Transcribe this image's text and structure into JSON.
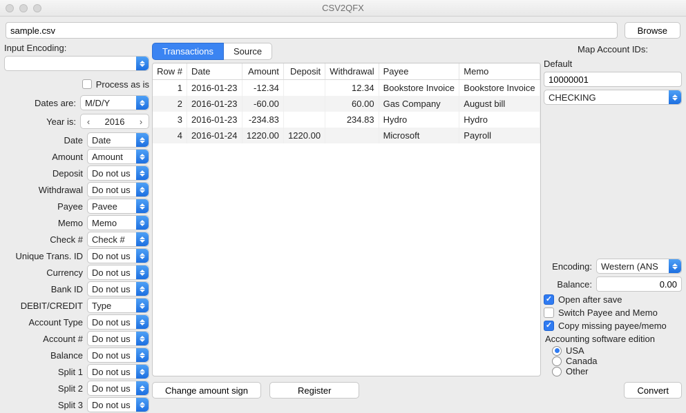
{
  "window": {
    "title": "CSV2QFX"
  },
  "filebar": {
    "path": "sample.csv",
    "browse": "Browse"
  },
  "left": {
    "input_encoding_label": "Input Encoding:",
    "input_encoding_value": "",
    "process_as_is": "Process as is",
    "dates_are_label": "Dates are:",
    "dates_are_value": "M/D/Y",
    "year_is_label": "Year is:",
    "year_is_value": "2016",
    "fields": [
      {
        "label": "Date",
        "value": "Date"
      },
      {
        "label": "Amount",
        "value": "Amount"
      },
      {
        "label": "Deposit",
        "value": "Do not us"
      },
      {
        "label": "Withdrawal",
        "value": "Do not us"
      },
      {
        "label": "Payee",
        "value": "Pavee"
      },
      {
        "label": "Memo",
        "value": "Memo"
      },
      {
        "label": "Check #",
        "value": "Check #"
      },
      {
        "label": "Unique Trans. ID",
        "value": "Do not us"
      },
      {
        "label": "Currency",
        "value": "Do not us"
      },
      {
        "label": "Bank ID",
        "value": "Do not us"
      },
      {
        "label": "DEBIT/CREDIT",
        "value": "Type"
      },
      {
        "label": "Account Type",
        "value": "Do not us"
      },
      {
        "label": "Account #",
        "value": "Do not us"
      },
      {
        "label": "Balance",
        "value": "Do not us"
      },
      {
        "label": "Split 1",
        "value": "Do not us"
      },
      {
        "label": "Split 2",
        "value": "Do not us"
      },
      {
        "label": "Split 3",
        "value": "Do not us"
      }
    ]
  },
  "tabs": {
    "transactions": "Transactions",
    "source": "Source"
  },
  "table": {
    "headers": [
      "Row #",
      "Date",
      "Amount",
      "Deposit",
      "Withdrawal",
      "Payee",
      "Memo"
    ],
    "rows": [
      {
        "row": "1",
        "date": "2016-01-23",
        "amount": "-12.34",
        "deposit": "",
        "withdrawal": "12.34",
        "payee": "Bookstore Invoice",
        "memo": "Bookstore Invoice"
      },
      {
        "row": "2",
        "date": "2016-01-23",
        "amount": "-60.00",
        "deposit": "",
        "withdrawal": "60.00",
        "payee": "Gas Company",
        "memo": "August bill"
      },
      {
        "row": "3",
        "date": "2016-01-23",
        "amount": "-234.83",
        "deposit": "",
        "withdrawal": "234.83",
        "payee": "Hydro",
        "memo": "Hydro"
      },
      {
        "row": "4",
        "date": "2016-01-24",
        "amount": "1220.00",
        "deposit": "1220.00",
        "withdrawal": "",
        "payee": "Microsoft",
        "memo": "Payroll"
      }
    ]
  },
  "bottom": {
    "change_sign": "Change amount sign",
    "register": "Register"
  },
  "right": {
    "map_title": "Map Account IDs:",
    "default_label": "Default",
    "default_value": "10000001",
    "account_type": "CHECKING",
    "encoding_label": "Encoding:",
    "encoding_value": "Western (ANS",
    "balance_label": "Balance:",
    "balance_value": "0.00",
    "open_after_save": "Open after save",
    "switch_payee_memo": "Switch Payee and Memo",
    "copy_missing": "Copy missing payee/memo",
    "accounting_edition": "Accounting software edition",
    "radio_usa": "USA",
    "radio_canada": "Canada",
    "radio_other": "Other",
    "convert": "Convert"
  }
}
